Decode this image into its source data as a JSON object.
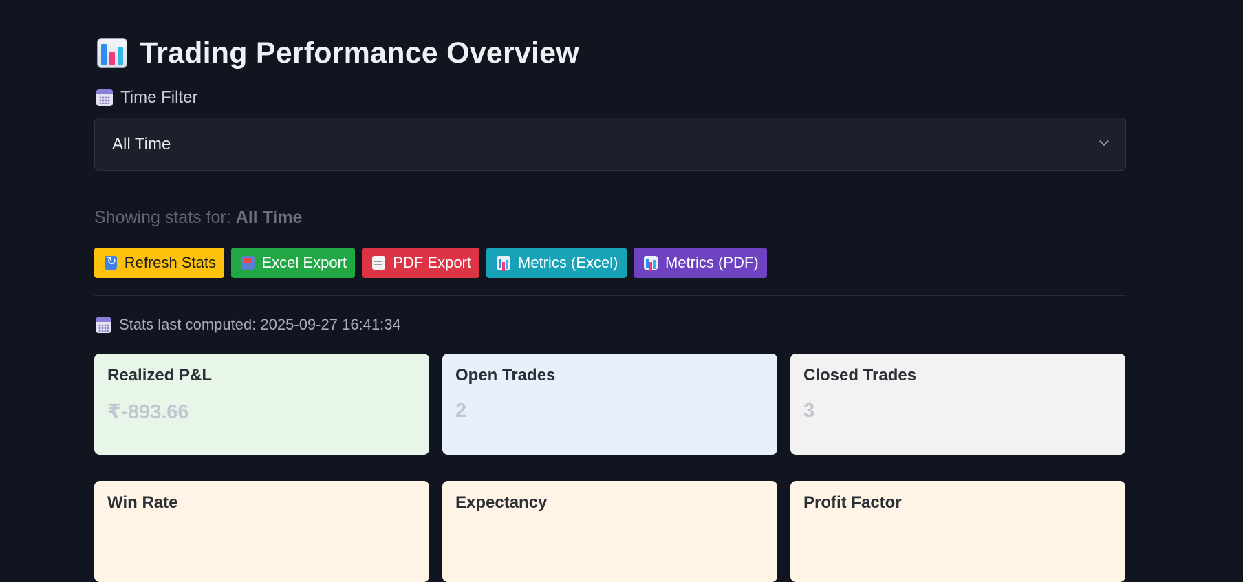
{
  "header": {
    "title_icon": "bar-chart-icon",
    "title": "Trading Performance Overview"
  },
  "filter": {
    "label_icon": "calendar-icon",
    "label": "Time Filter",
    "selected": "All Time"
  },
  "showing": {
    "prefix": "Showing stats for:",
    "value": "All Time"
  },
  "actions": [
    {
      "icon": "refresh-icon",
      "label": "Refresh Stats",
      "color": "#fec10c"
    },
    {
      "icon": "inbox-icon",
      "label": "Excel Export",
      "color": "#22a745"
    },
    {
      "icon": "receipt-icon",
      "label": "PDF Export",
      "color": "#dc3444"
    },
    {
      "icon": "bar-chart-icon",
      "label": "Metrics (Excel)",
      "color": "#17a2b8"
    },
    {
      "icon": "bar-chart-icon",
      "label": "Metrics (PDF)",
      "color": "#6e42c1"
    }
  ],
  "computed": {
    "icon": "calendar-icon",
    "text": "Stats last computed: 2025-09-27 16:41:34"
  },
  "cards": [
    {
      "title": "Realized P&L",
      "value": "₹-893.66",
      "color": "#e8f5e9"
    },
    {
      "title": "Open Trades",
      "value": "2",
      "color": "#e8f1fb"
    },
    {
      "title": "Closed Trades",
      "value": "3",
      "color": "#f2f2f2"
    },
    {
      "title": "Win Rate",
      "color": "#fff4e5"
    },
    {
      "title": "Expectancy",
      "color": "#fff4e5"
    },
    {
      "title": "Profit Factor",
      "color": "#fff4e5"
    }
  ]
}
